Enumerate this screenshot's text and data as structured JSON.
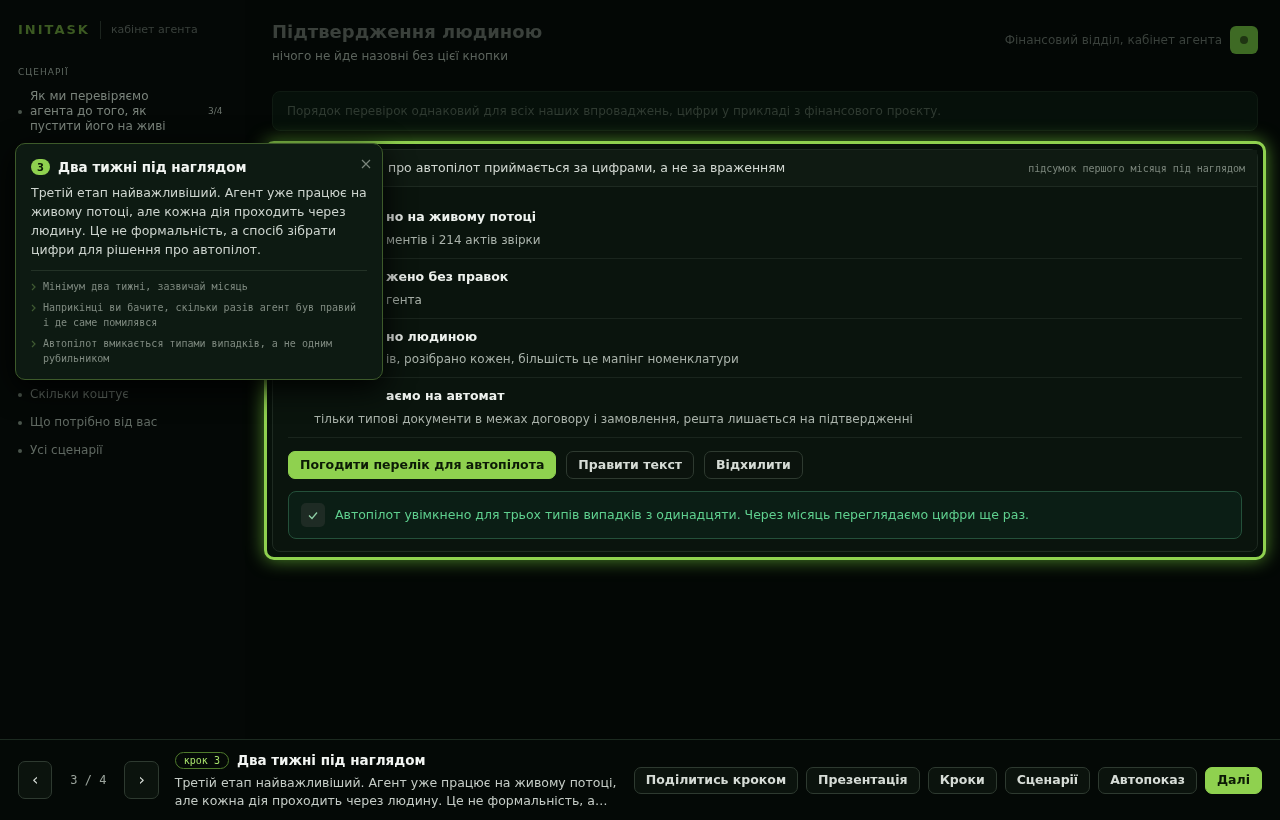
{
  "sidebar": {
    "brand": "INITASK",
    "subtitle": "кабінет агента",
    "section": "СЦЕНАРІЇ",
    "items": [
      {
        "label": "Як ми перевіряємо агента до того, як пустити його на живі",
        "count": "3/4",
        "selected": true
      },
      {
        "label": "Скільки коштує",
        "selected": false
      },
      {
        "label": "Що потрібно від вас",
        "selected": false
      },
      {
        "label": "Усі сценарії",
        "selected": false
      }
    ]
  },
  "header": {
    "title": "Підтвердження людиною",
    "subtitle": "нічого не йде назовні без цієї кнопки",
    "account": "Фінансовий відділ, кабінет агента"
  },
  "banner": "Порядок перевірок однаковий для всіх наших впроваджень, цифри у прикладі з фінансового проєкту.",
  "card": {
    "header": "про автопілот приймається за цифрами, а не за враженням",
    "note": "підсумок першого місяця під наглядом",
    "items": [
      {
        "title": "но на живому потоці",
        "detail": "ментів і 214 актів звірки"
      },
      {
        "title": "жено без правок",
        "detail": "гента"
      },
      {
        "title": "но людиною",
        "detail": "ів, розібрано кожен, більшість це мапінг номенклатури"
      },
      {
        "title": "аємо на автомат",
        "detail": "тільки типові документи в межах договору і замовлення, решта лишається на підтвердженні"
      }
    ],
    "actions": [
      {
        "label": "Погодити перелік для автопілота",
        "kind": "primary"
      },
      {
        "label": "Правити текст",
        "kind": "secondary"
      },
      {
        "label": "Відхилити",
        "kind": "secondary"
      }
    ],
    "result": "Автопілот увімкнено для трьох типів випадків з одинадцяти. Через місяць переглядаємо цифри ще раз."
  },
  "popover": {
    "step": "3",
    "title": "Два тижні під наглядом",
    "text": "Третій етап найважливіший. Агент уже працює на живому потоці, але кожна дія проходить через людину. Це не формальність, а спосіб зібрати цифри для рішення про автопілот.",
    "points": [
      "Мінімум два тижні, зазвичай місяць",
      "Наприкінці ви бачите, скільки разів агент був правий і де саме помилявся",
      "Автопілот вмикається типами випадків, а не одним рубильником"
    ]
  },
  "footer": {
    "prev": "‹",
    "next": "›",
    "counter": "3 / 4",
    "badge": "крок 3",
    "title": "Два тижні під наглядом",
    "text": "Третій етап найважливіший. Агент уже працює на живому потоці, але кожна дія проходить через людину. Це не формальність, а…",
    "buttons": [
      {
        "label": "Поділитись кроком",
        "kind": "secondary"
      },
      {
        "label": "Презентація",
        "kind": "secondary"
      },
      {
        "label": "Кроки",
        "kind": "secondary"
      },
      {
        "label": "Сценарії",
        "kind": "secondary"
      },
      {
        "label": "Автопоказ",
        "kind": "secondary"
      },
      {
        "label": "Далі",
        "kind": "primary"
      }
    ]
  }
}
